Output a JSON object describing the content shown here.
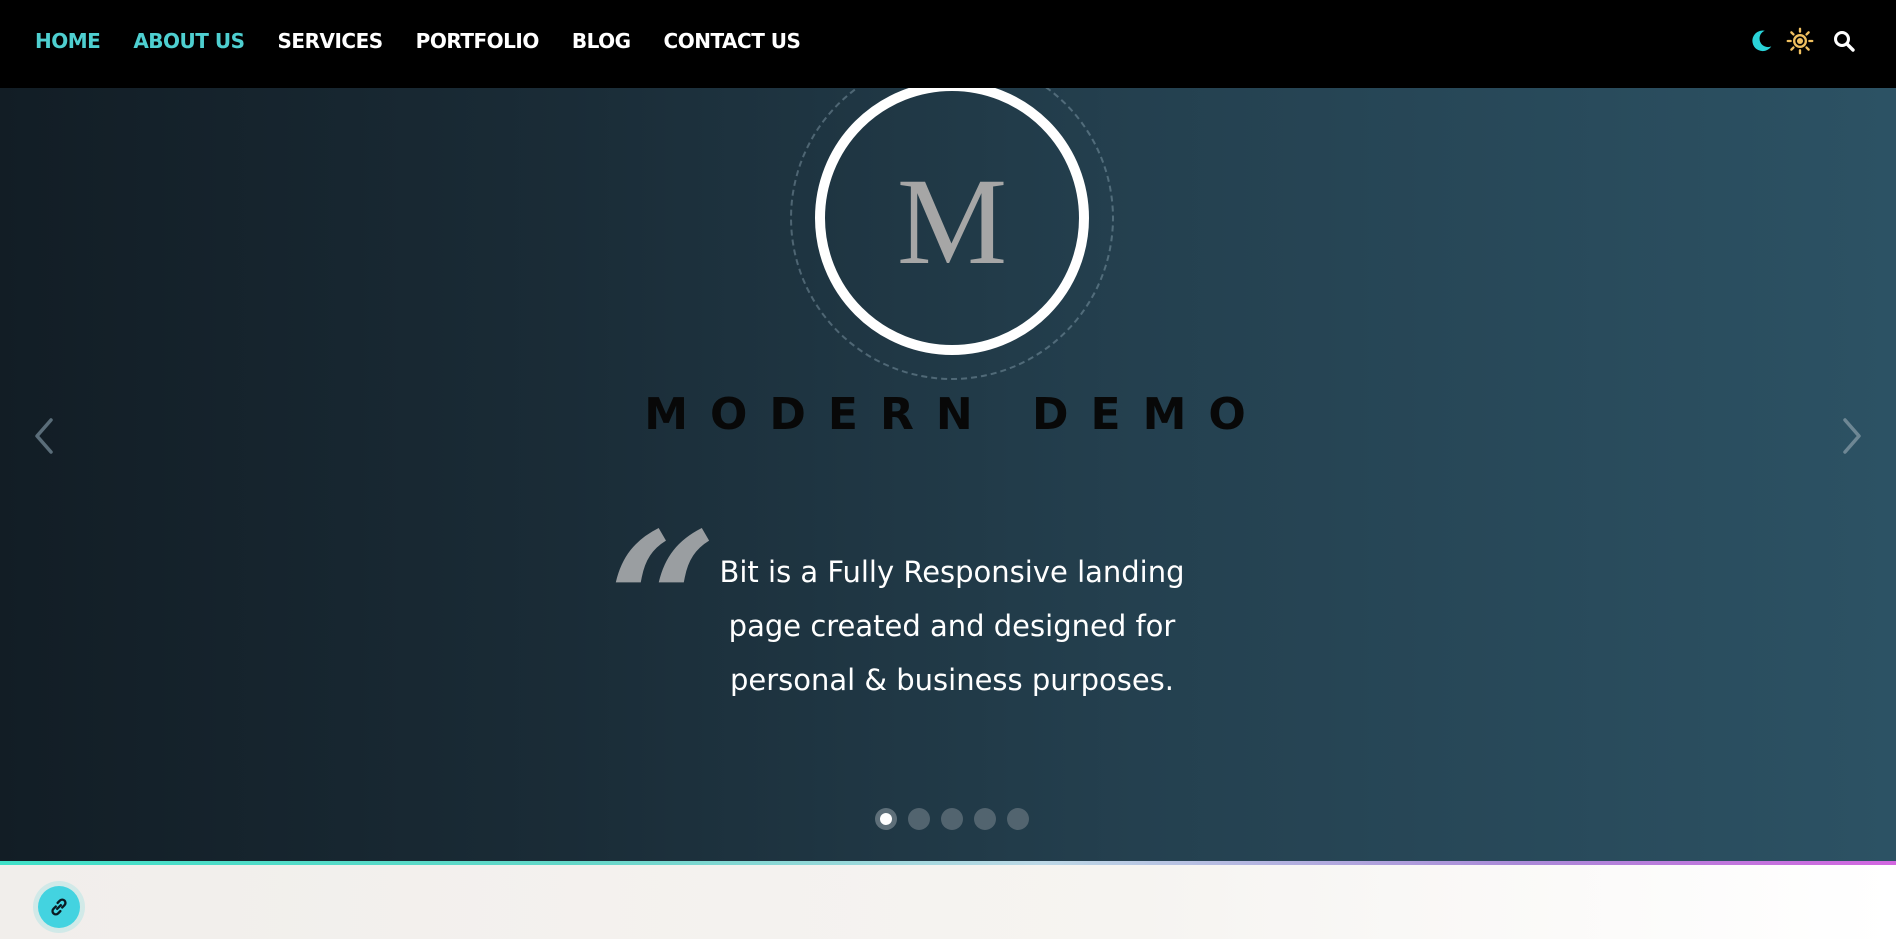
{
  "nav": {
    "links": [
      {
        "label": "HOME"
      },
      {
        "label": "ABOUT US"
      },
      {
        "label": "SERVICES"
      },
      {
        "label": "PORTFOLIO"
      },
      {
        "label": "BLOG"
      },
      {
        "label": "CONTACT US"
      }
    ],
    "active_color": "#4ecfd0",
    "icons": [
      "moon-icon",
      "sun-icon",
      "search-icon"
    ]
  },
  "hero": {
    "logo_letter": "M",
    "title": "MODERN DEMO",
    "quote_mark": "“",
    "description": "Bit is a Fully Responsive landing page created and designed for personal & business purposes.",
    "slide_count": 5,
    "active_slide": 1,
    "prev_icon": "chevron-left-icon",
    "next_icon": "chevron-right-icon"
  },
  "fab": {
    "icon": "link-icon",
    "color": "#43d3e0"
  }
}
